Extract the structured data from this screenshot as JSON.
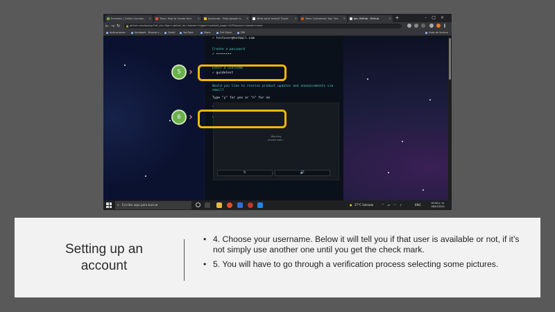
{
  "browser": {
    "tabs": [
      {
        "label": "Envestus | Online Courses –"
      },
      {
        "label": "Temx: How to Create Your"
      },
      {
        "label": "Javascript - Paso google ro"
      },
      {
        "label": "What went wrong? Troubl"
      },
      {
        "label": "Tema Customizer Your Terr"
      },
      {
        "label": "Join GitHub · GitHub",
        "active": true
      }
    ],
    "url": "github.com/signup?ref_cta=Sign+up&ref_loc=header+logged+out&ref_page=%2F&source=header-home",
    "bookmarks": [
      "Aplicaciones",
      "facebook - Buscar c...",
      "Gmail",
      "YouTube",
      "Maps",
      "Full Stack",
      "DM"
    ],
    "reading_list": "Lista de lectura"
  },
  "signup": {
    "email_line": "✓ testuser@hotmail.com",
    "password_prompt": "Create a password",
    "password_value": "✓ ••••••••",
    "username_prompt": "Enter a username",
    "username_value": "✓ guidetest",
    "updates_question": "Would you like to receive product updates and announcements via\nemail?",
    "updates_hint": "Type \"y\" for yes or \"n\" for no",
    "updates_answer": "✓ n",
    "verify_label": "Verify your account",
    "captcha_message": "Working\nplease wait..."
  },
  "annotations": {
    "step5": "5",
    "step6": "6",
    "highlight_color": "#f5b800",
    "step_color": "#6ab04c"
  },
  "taskbar": {
    "search_placeholder": "Escribe aquí para buscar",
    "weather": "27°C  Soleado",
    "language": "ENG",
    "time": "04:40 p. m.",
    "date": "06/07/2021"
  },
  "caption": {
    "title": "Setting up an account",
    "bullets": [
      "4. Choose  your username. Below it will tell you if that user is available or not, if it’s not simply  use another one until you get the check mark.",
      "5. You will have to go through a verification process selecting some pictures."
    ]
  }
}
